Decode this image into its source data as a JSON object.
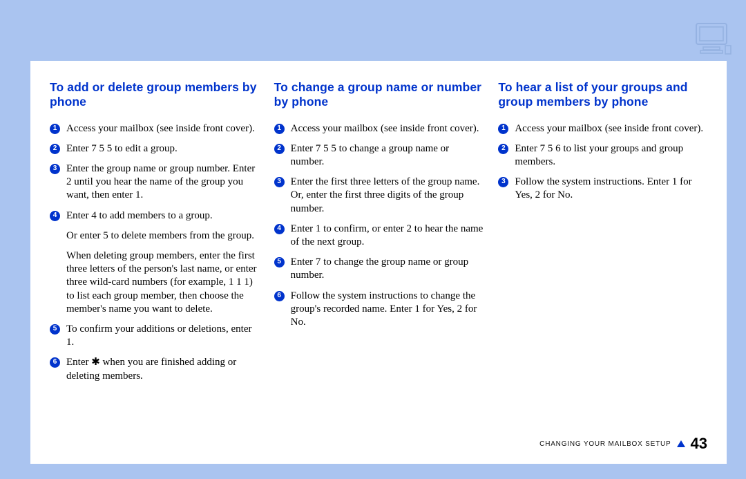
{
  "columns": [
    {
      "heading": "To add or delete group members by phone",
      "items": [
        {
          "n": "1",
          "text": "Access your mailbox (see inside front cover)."
        },
        {
          "n": "2",
          "text": "Enter 7 5 5 to edit a group."
        },
        {
          "n": "3",
          "text": "Enter the group name or group number. Enter 2 until you hear the name of the group you want, then enter 1."
        },
        {
          "n": "4",
          "text": "Enter 4 to add members to a group.",
          "subs": [
            "Or enter 5 to delete members from the group.",
            "When deleting group members, enter the first three letters of the person's last name, or enter three wild-card numbers (for example, 1 1 1) to list each group member, then choose the member's name you want to delete."
          ]
        },
        {
          "n": "5",
          "text": "To confirm your additions or deletions, enter 1."
        },
        {
          "n": "6",
          "text": "Enter ✱ when you are finished adding or deleting members."
        }
      ]
    },
    {
      "heading": "To change a group name or number by phone",
      "items": [
        {
          "n": "1",
          "text": "Access your mailbox (see inside front cover)."
        },
        {
          "n": "2",
          "text": "Enter 7 5 5 to change a group name or number."
        },
        {
          "n": "3",
          "text": "Enter the first three letters of the group name. Or, enter the first three digits of the group number."
        },
        {
          "n": "4",
          "text": "Enter 1 to confirm, or enter 2 to hear the name of the next group."
        },
        {
          "n": "5",
          "text": "Enter 7 to change the group name or group number."
        },
        {
          "n": "6",
          "text": "Follow the system instructions to change the group's recorded name. Enter 1 for Yes, 2 for No."
        }
      ]
    },
    {
      "heading": "To hear a list of your groups and group members by phone",
      "items": [
        {
          "n": "1",
          "text": "Access your mailbox (see inside front cover)."
        },
        {
          "n": "2",
          "text": "Enter 7 5 6 to list your groups and group members."
        },
        {
          "n": "3",
          "text": "Follow the system instructions. Enter 1 for Yes, 2 for No."
        }
      ]
    }
  ],
  "footer": {
    "label": "CHANGING YOUR MAILBOX SETUP",
    "page": "43"
  }
}
